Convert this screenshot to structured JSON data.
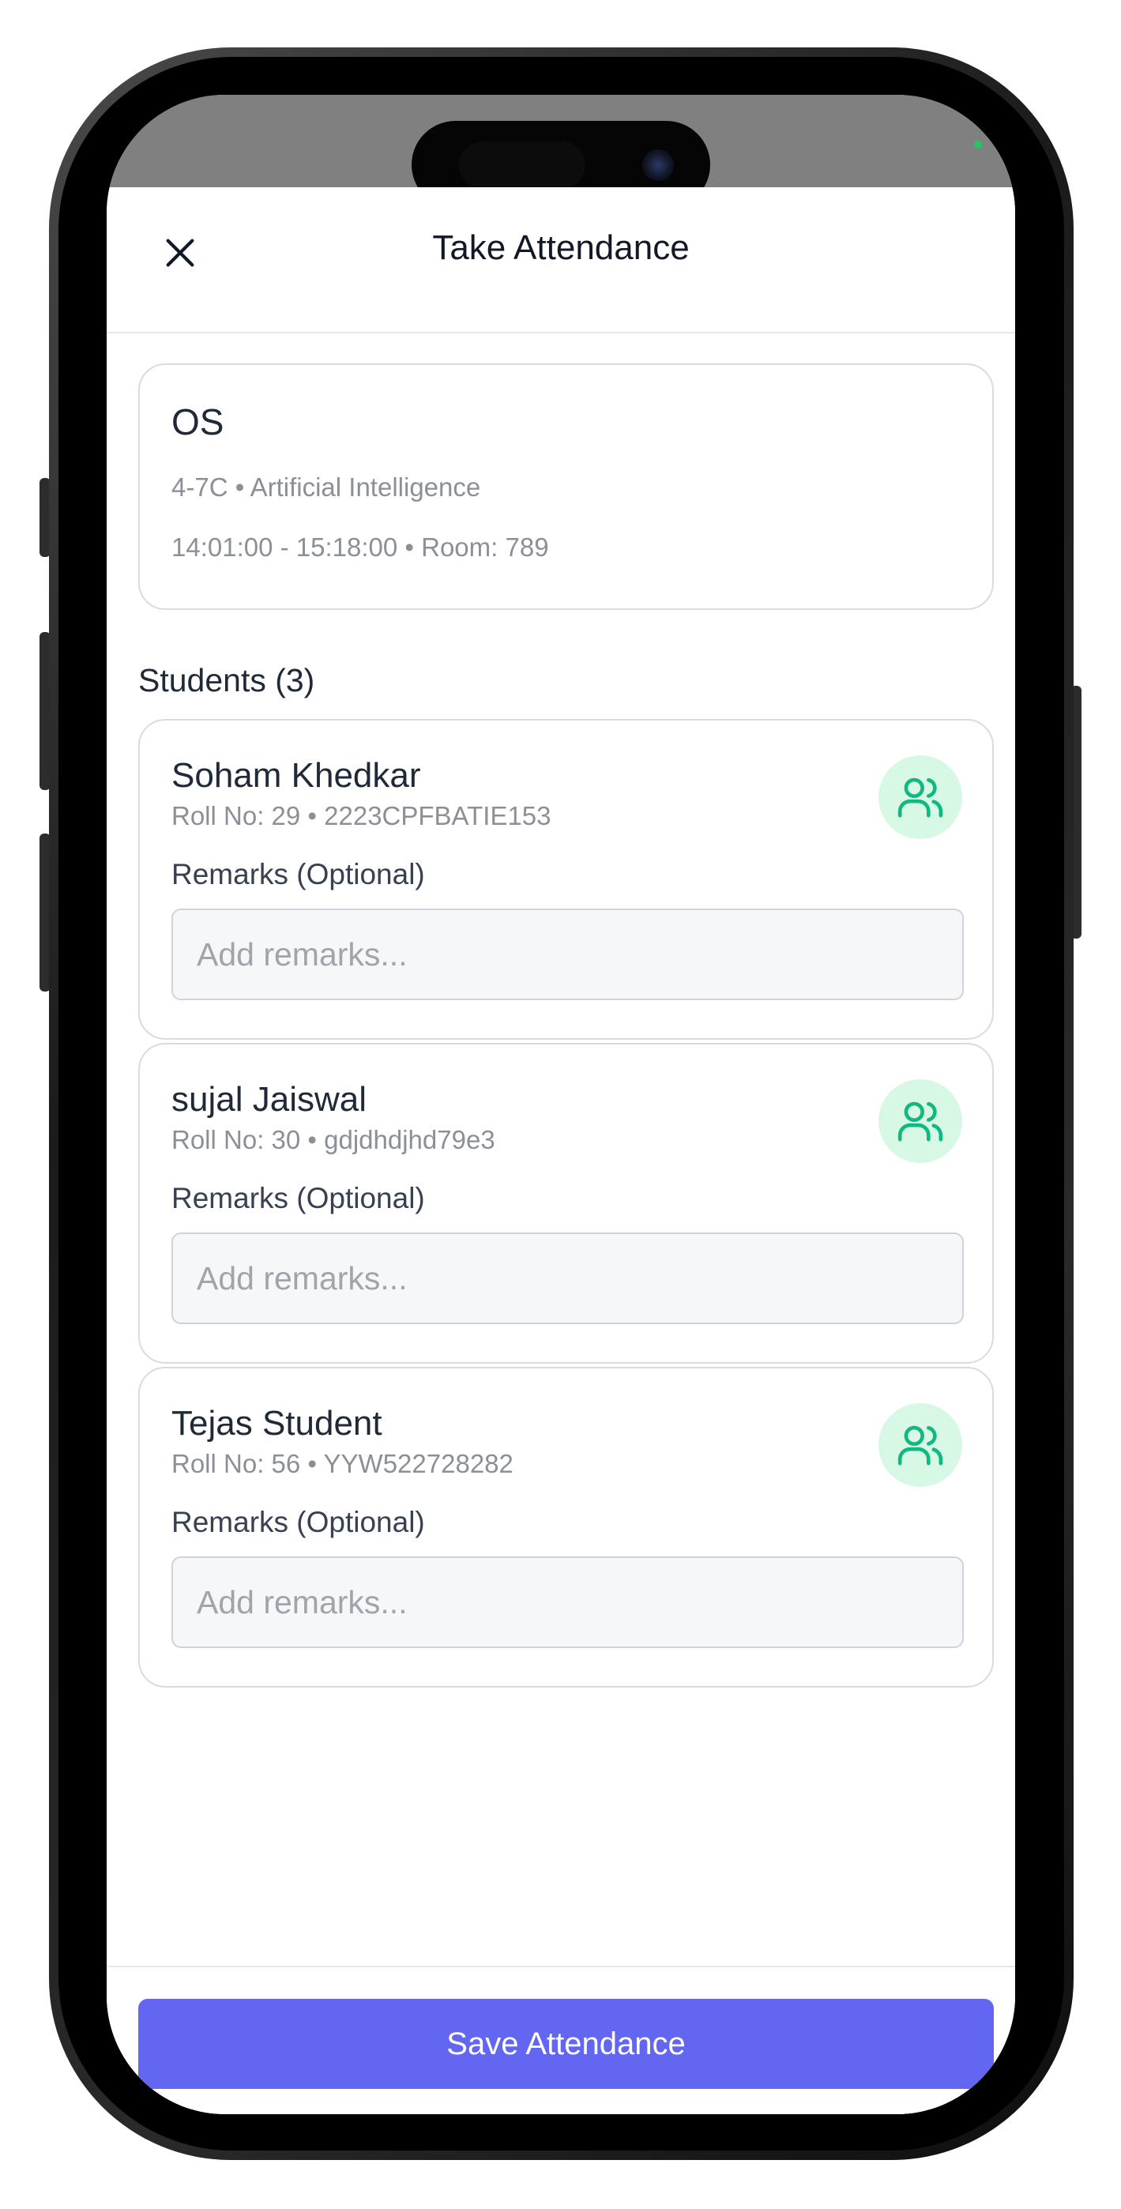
{
  "header": {
    "title": "Take Attendance",
    "close_icon": "close-icon"
  },
  "class_info": {
    "name": "OS",
    "division_subject": "4-7C • Artificial Intelligence",
    "time_room": "14:01:00 - 15:18:00 • Room: 789"
  },
  "students_section": {
    "title": "Students (3)"
  },
  "students": [
    {
      "name": "Soham Khedkar",
      "meta": "Roll No: 29 • 2223CPFBATIE153",
      "remarks_label": "Remarks (Optional)",
      "remarks_placeholder": "Add remarks...",
      "remarks_value": "",
      "status_icon": "users-icon"
    },
    {
      "name": "sujal Jaiswal",
      "meta": "Roll No: 30 • gdjdhdjhd79e3",
      "remarks_label": "Remarks (Optional)",
      "remarks_placeholder": "Add remarks...",
      "remarks_value": "",
      "status_icon": "users-icon"
    },
    {
      "name": "Tejas Student",
      "meta": "Roll No: 56 • YYW522728282",
      "remarks_label": "Remarks (Optional)",
      "remarks_placeholder": "Add remarks...",
      "remarks_value": "",
      "status_icon": "users-icon"
    }
  ],
  "footer": {
    "save_label": "Save Attendance"
  },
  "colors": {
    "primary": "#6366f1",
    "status_green": "#10b981",
    "status_green_bg": "#d8f8e6",
    "status_bar": "#7f807f"
  }
}
